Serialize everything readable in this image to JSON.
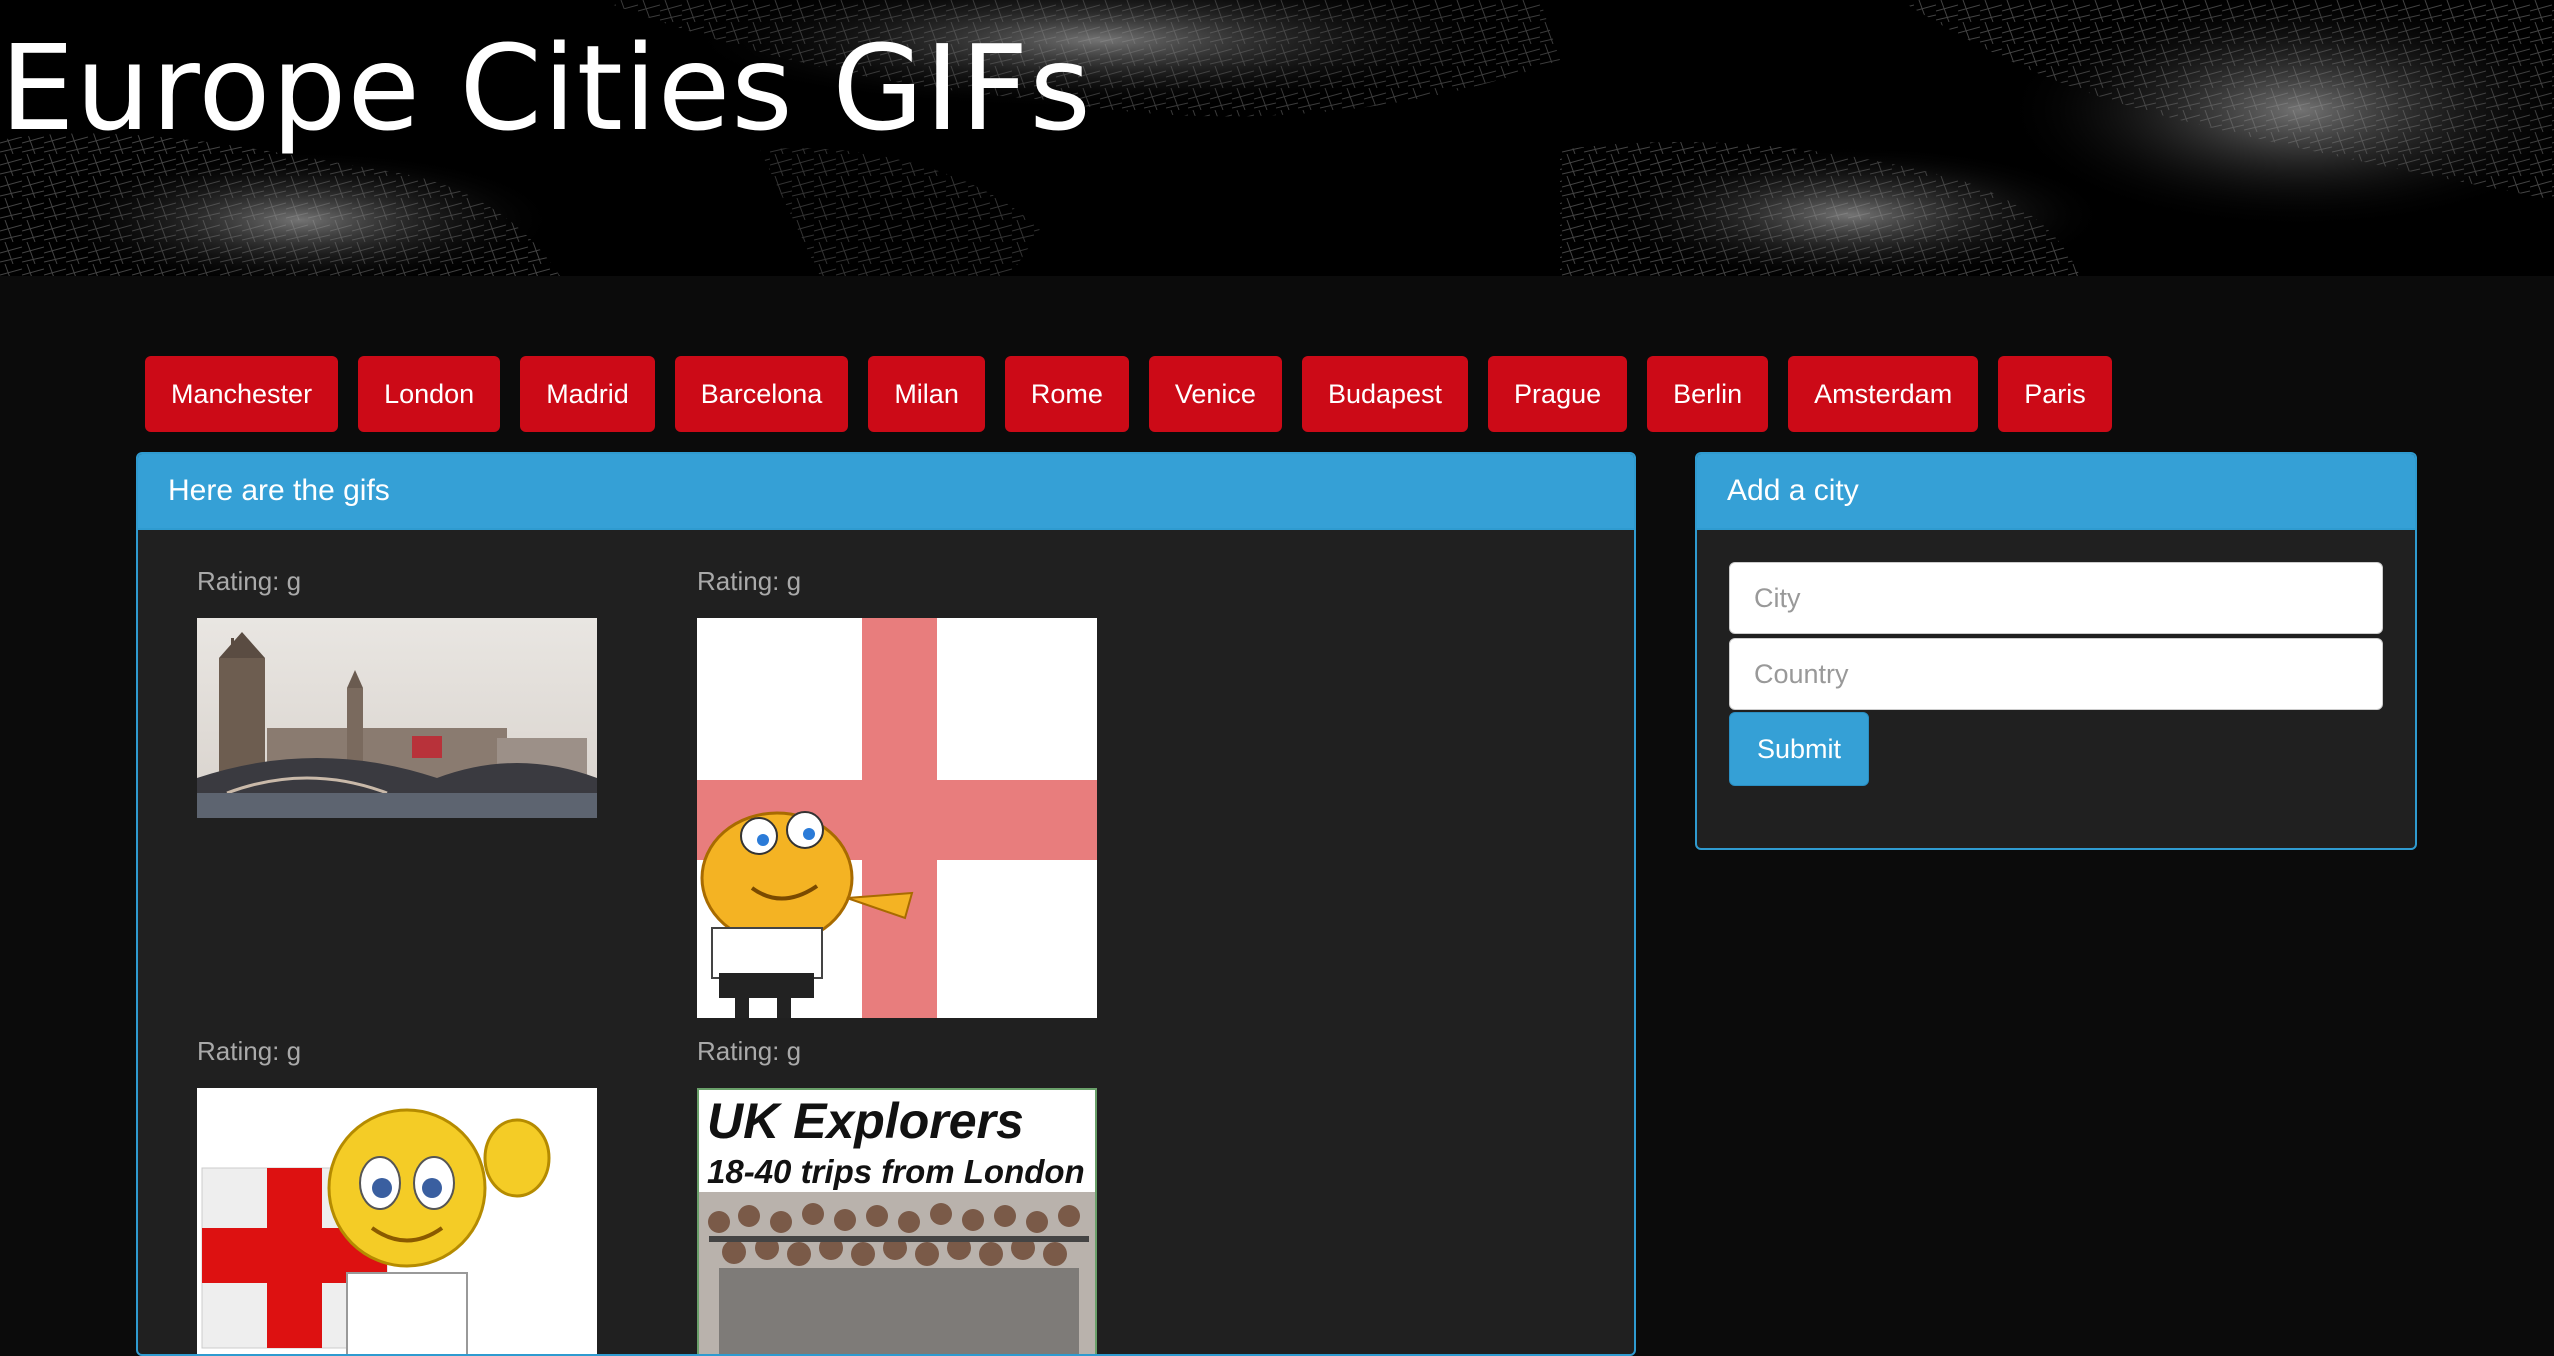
{
  "header": {
    "title": "Europe Cities GIFs"
  },
  "city_buttons": [
    "Manchester",
    "London",
    "Madrid",
    "Barcelona",
    "Milan",
    "Rome",
    "Venice",
    "Budapest",
    "Prague",
    "Berlin",
    "Amsterdam",
    "Paris"
  ],
  "gifs_panel": {
    "heading": "Here are the gifs",
    "items": [
      {
        "rating": "Rating: g",
        "image": "london-skyline-gif"
      },
      {
        "rating": "Rating: g",
        "image": "england-flag-smiley-gif"
      },
      {
        "rating": "Rating: g",
        "image": "waving-smiley-england-gif"
      },
      {
        "rating": "Rating: g",
        "image": "uk-explorers-gif",
        "caption_line1": "UK Explorers",
        "caption_line2": "18-40 trips from London"
      }
    ]
  },
  "add_city_panel": {
    "heading": "Add a city",
    "city_placeholder": "City",
    "country_placeholder": "Country",
    "submit_label": "Submit"
  },
  "colors": {
    "city_button": "#cc0a17",
    "panel_heading": "#35a0d6",
    "panel_body": "#202020",
    "page_background": "#0b0b0b"
  }
}
